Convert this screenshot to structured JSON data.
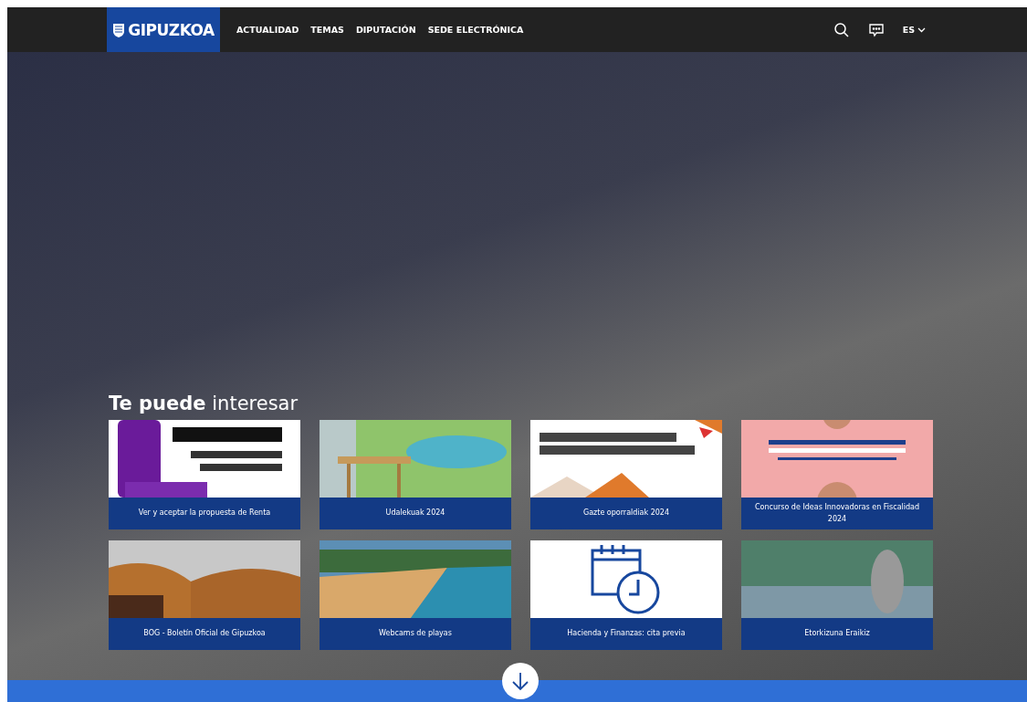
{
  "header": {
    "logo": "GIPUZKOA",
    "nav": [
      "ACTUALIDAD",
      "TEMAS",
      "DIPUTACIÓN",
      "SEDE ELECTRÓNICA"
    ],
    "language": "ES"
  },
  "section": {
    "title": "**Te puede** interesar",
    "cards": [
      {
        "kind": "errenta",
        "caption": "Ver y aceptar la propuesta de Renta"
      },
      {
        "kind": "camp",
        "caption": "Udalekuak 2024"
      },
      {
        "kind": "gazte",
        "caption": "Gazte oporraldiak 2024"
      },
      {
        "kind": "contest",
        "caption": "Concurso de Ideas Innovadoras en Fiscalidad 2024"
      },
      {
        "kind": "book",
        "caption": "BOG - Boletín Oficial de Gipuzkoa"
      },
      {
        "kind": "beach",
        "caption": "Webcams de playas"
      },
      {
        "kind": "calendar",
        "caption": "Hacienda y Finanzas: cita previa"
      },
      {
        "kind": "path",
        "caption": "Etorkizuna Eraikiz"
      }
    ]
  }
}
